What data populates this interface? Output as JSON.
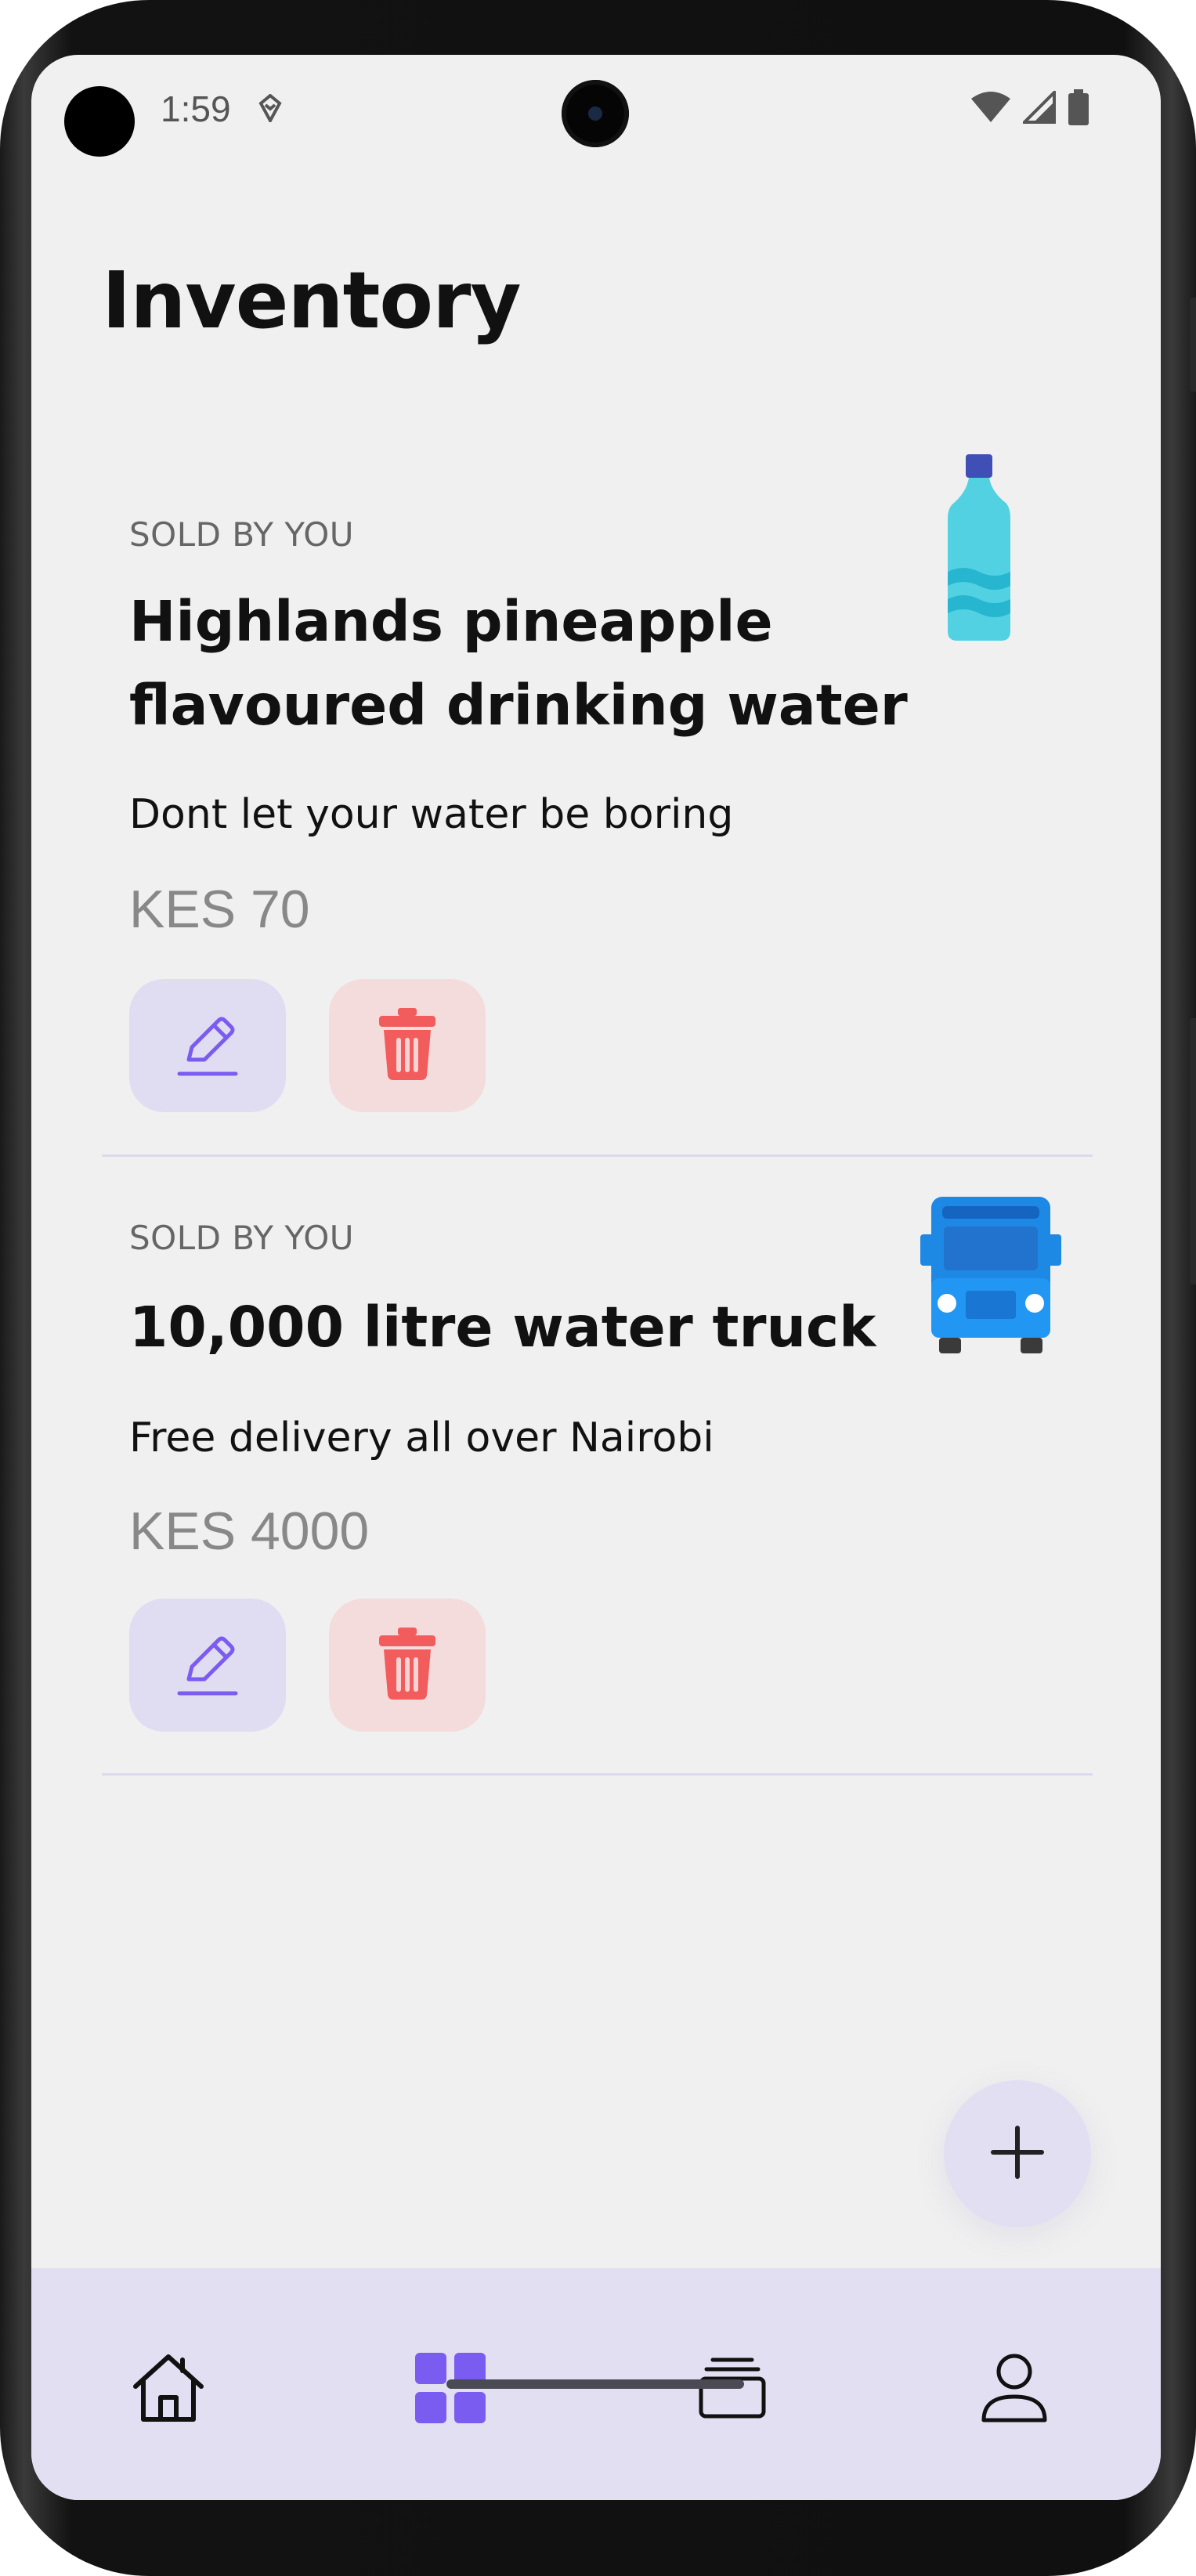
{
  "status_bar": {
    "time": "1:59",
    "icons": [
      "location-pin-icon",
      "wifi-icon",
      "signal-icon",
      "battery-icon"
    ]
  },
  "page": {
    "title": "Inventory"
  },
  "items": [
    {
      "label": "SOLD BY YOU",
      "title": "Highlands pineapple flavoured drinking water",
      "description": "Dont let your water be boring",
      "price": "KES 70",
      "thumbnail_icon": "water-bottle-icon"
    },
    {
      "label": "SOLD BY YOU",
      "title": "10,000 litre water truck",
      "description": "Free delivery all over Nairobi",
      "price": "KES 4000",
      "thumbnail_icon": "water-truck-icon"
    }
  ],
  "actions": {
    "edit_icon": "pencil-icon",
    "delete_icon": "trash-icon",
    "add_icon": "plus-icon"
  },
  "bottom_nav": {
    "items": [
      {
        "icon": "home-icon",
        "active": false
      },
      {
        "icon": "grid-icon",
        "active": true
      },
      {
        "icon": "stack-icon",
        "active": false
      },
      {
        "icon": "profile-icon",
        "active": false
      }
    ]
  },
  "colors": {
    "accent": "#7b5cf0",
    "edit_bg": "#e0ddf2",
    "delete_bg": "#f5dcdc",
    "delete_icon": "#f25c5c",
    "nav_bg": "#e2dff2",
    "screen_bg": "#f0f0f0"
  }
}
